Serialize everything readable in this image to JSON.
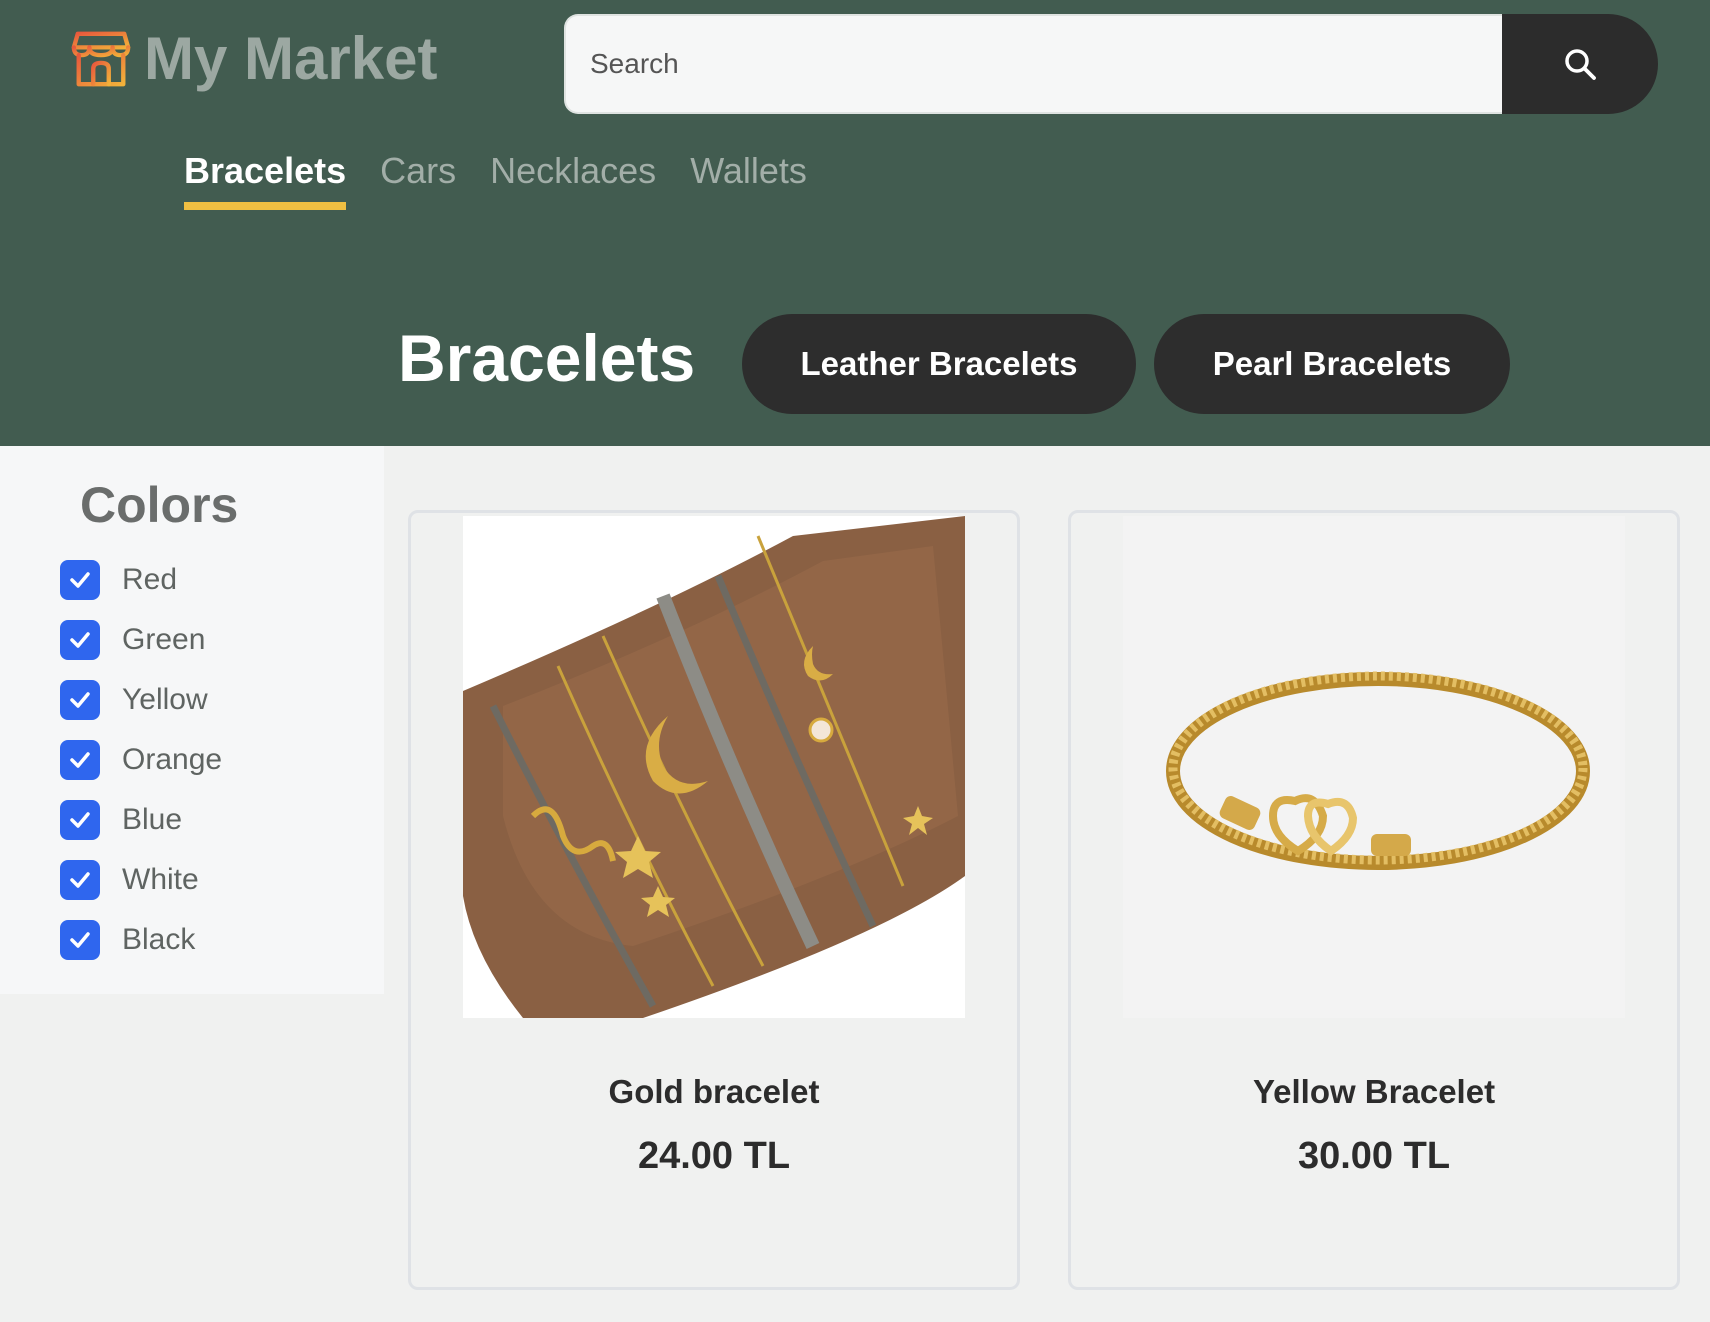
{
  "header": {
    "logo_text": "My Market",
    "logo_icon": "storefront-icon",
    "search": {
      "placeholder": "Search",
      "button_icon": "search-icon"
    },
    "tabs": [
      {
        "label": "Bracelets",
        "active": true
      },
      {
        "label": "Cars",
        "active": false
      },
      {
        "label": "Necklaces",
        "active": false
      },
      {
        "label": "Wallets",
        "active": false
      }
    ],
    "page_title": "Bracelets",
    "subcategories": [
      "Leather Bracelets",
      "Pearl Bracelets"
    ]
  },
  "filters": {
    "title": "Colors",
    "colors": [
      {
        "label": "Red",
        "checked": true
      },
      {
        "label": "Green",
        "checked": true
      },
      {
        "label": "Yellow",
        "checked": true
      },
      {
        "label": "Orange",
        "checked": true
      },
      {
        "label": "Blue",
        "checked": true
      },
      {
        "label": "White",
        "checked": true
      },
      {
        "label": "Black",
        "checked": true
      }
    ]
  },
  "products": [
    {
      "name": "Gold bracelet",
      "price": "24.00 TL"
    },
    {
      "name": "Yellow Bracelet",
      "price": "30.00 TL"
    }
  ],
  "colors": {
    "header_bg": "#425c50",
    "accent_underline": "#f0bf42",
    "checkbox": "#2f66ee",
    "dark_button": "#2d2d2d"
  }
}
